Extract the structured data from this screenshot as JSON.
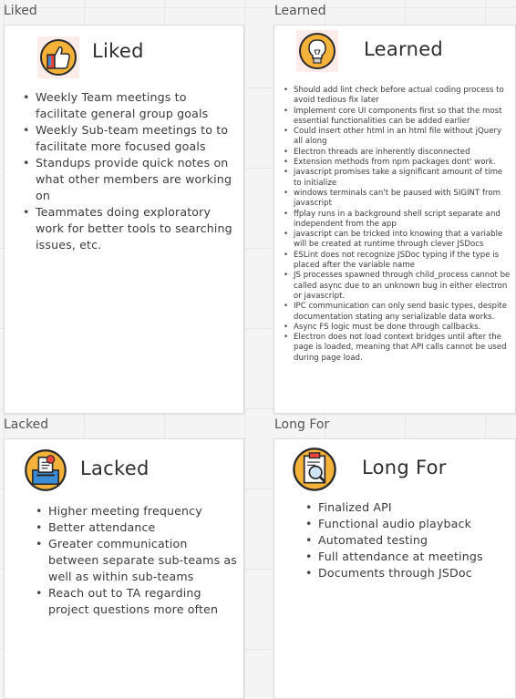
{
  "sections": {
    "liked": {
      "label": "Liked",
      "title": "Liked",
      "icon": "thumbs-up-icon",
      "items": [
        "Weekly Team meetings to facilitate general group goals",
        "Weekly Sub-team meetings to  to facilitate more focused goals",
        "Standups provide quick notes on what other members are working on",
        "Teammates doing exploratory work for better tools to searching issues, etc."
      ]
    },
    "learned": {
      "label": "Learned",
      "title": "Learned",
      "icon": "lightbulb-icon",
      "items": [
        "Should add lint check before actual coding process to avoid tedious fix later",
        "Implement core UI components first so that the most essential functionalities can be added earlier",
        "Could insert other html in an html file without jQuery all along",
        "Electron threads are inherently disconnected",
        "Extension methods from npm packages dont' work.",
        "javascript promises take a significant amount of time to initialize",
        "windows terminals can't be paused with SIGINT from javascript",
        "ffplay runs in a background shell script separate and independent from the app",
        "javascript can be tricked into knowing that a variable will be created at runtime through clever JSDocs",
        "ESLint does not recognize JSDoc typing if the type is placed after the variable name",
        "JS processes spawned through child_process cannot be called async due to an unknown bug in either electron or javascript.",
        "IPC communication can only send basic types, despite documentation stating any serializable data works.",
        "Async FS logic must be done through callbacks.",
        "Electron does not load context bridges until after the page is loaded, meaning that API calls cannot be used during page load."
      ]
    },
    "lacked": {
      "label": "Lacked",
      "title": "Lacked",
      "icon": "ballot-box-icon",
      "items": [
        "Higher meeting frequency",
        "Better attendance",
        "Greater communication between separate sub-teams as well as within sub-teams",
        "Reach out to TA regarding project questions more often"
      ]
    },
    "long_for": {
      "label": "Long For",
      "title": "Long For",
      "icon": "clipboard-search-icon",
      "items": [
        "Finalized API",
        "Functional audio playback",
        "Automated testing",
        "Full attendance at meetings",
        "Documents through JSDoc"
      ]
    }
  },
  "colors": {
    "background": "#f4f4f4",
    "card": "#ffffff",
    "icon_ring": "#f5b23a",
    "icon_dark": "#2a2a2a",
    "icon_accent_red": "#e8453c",
    "icon_accent_blue": "#3c8dd8"
  }
}
